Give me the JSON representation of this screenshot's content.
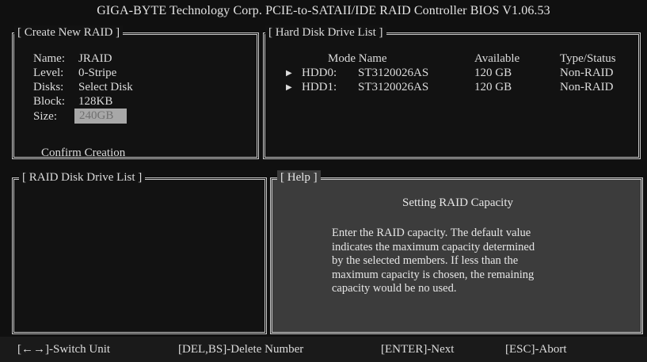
{
  "title": "GIGA-BYTE Technology Corp. PCIE-to-SATAII/IDE RAID Controller BIOS V1.06.53",
  "create_raid": {
    "title": "[ Create New RAID ]",
    "fields": [
      {
        "label": "Name:",
        "value": "JRAID"
      },
      {
        "label": "Level:",
        "value": "0-Stripe"
      },
      {
        "label": "Disks:",
        "value": "Select Disk"
      },
      {
        "label": "Block:",
        "value": "128KB"
      },
      {
        "label": "Size:",
        "value": "240GB"
      }
    ],
    "confirm": "Confirm Creation"
  },
  "hdd_list": {
    "title": "[ Hard Disk Drive List ]",
    "headers": {
      "mode_name": "Mode Name",
      "available": "Available",
      "type_status": "Type/Status"
    },
    "rows": [
      {
        "id": "HDD0:",
        "model": "ST3120026AS",
        "available": "120 GB",
        "status": "Non-RAID"
      },
      {
        "id": "HDD1:",
        "model": "ST3120026AS",
        "available": "120 GB",
        "status": "Non-RAID"
      }
    ]
  },
  "raid_list": {
    "title": "[ RAID Disk Drive List ]"
  },
  "help": {
    "title": "[ Help ]",
    "heading": "Setting RAID Capacity",
    "lines": [
      "Enter the RAID capacity. The default value",
      "indicates the maximum capacity determined",
      "by the selected members. If less than the",
      "maximum capacity is chosen, the remaining",
      "capacity would be no used."
    ]
  },
  "footer": {
    "switch_unit": "[←→]-Switch Unit",
    "delete_number": "[DEL,BS]-Delete Number",
    "next": "[ENTER]-Next",
    "abort": "[ESC]-Abort"
  },
  "colors": {
    "background": "#101010",
    "help_panel": "#3c3c3c",
    "size_highlight": "#a8a8a8",
    "border": "#c8c8c8"
  }
}
